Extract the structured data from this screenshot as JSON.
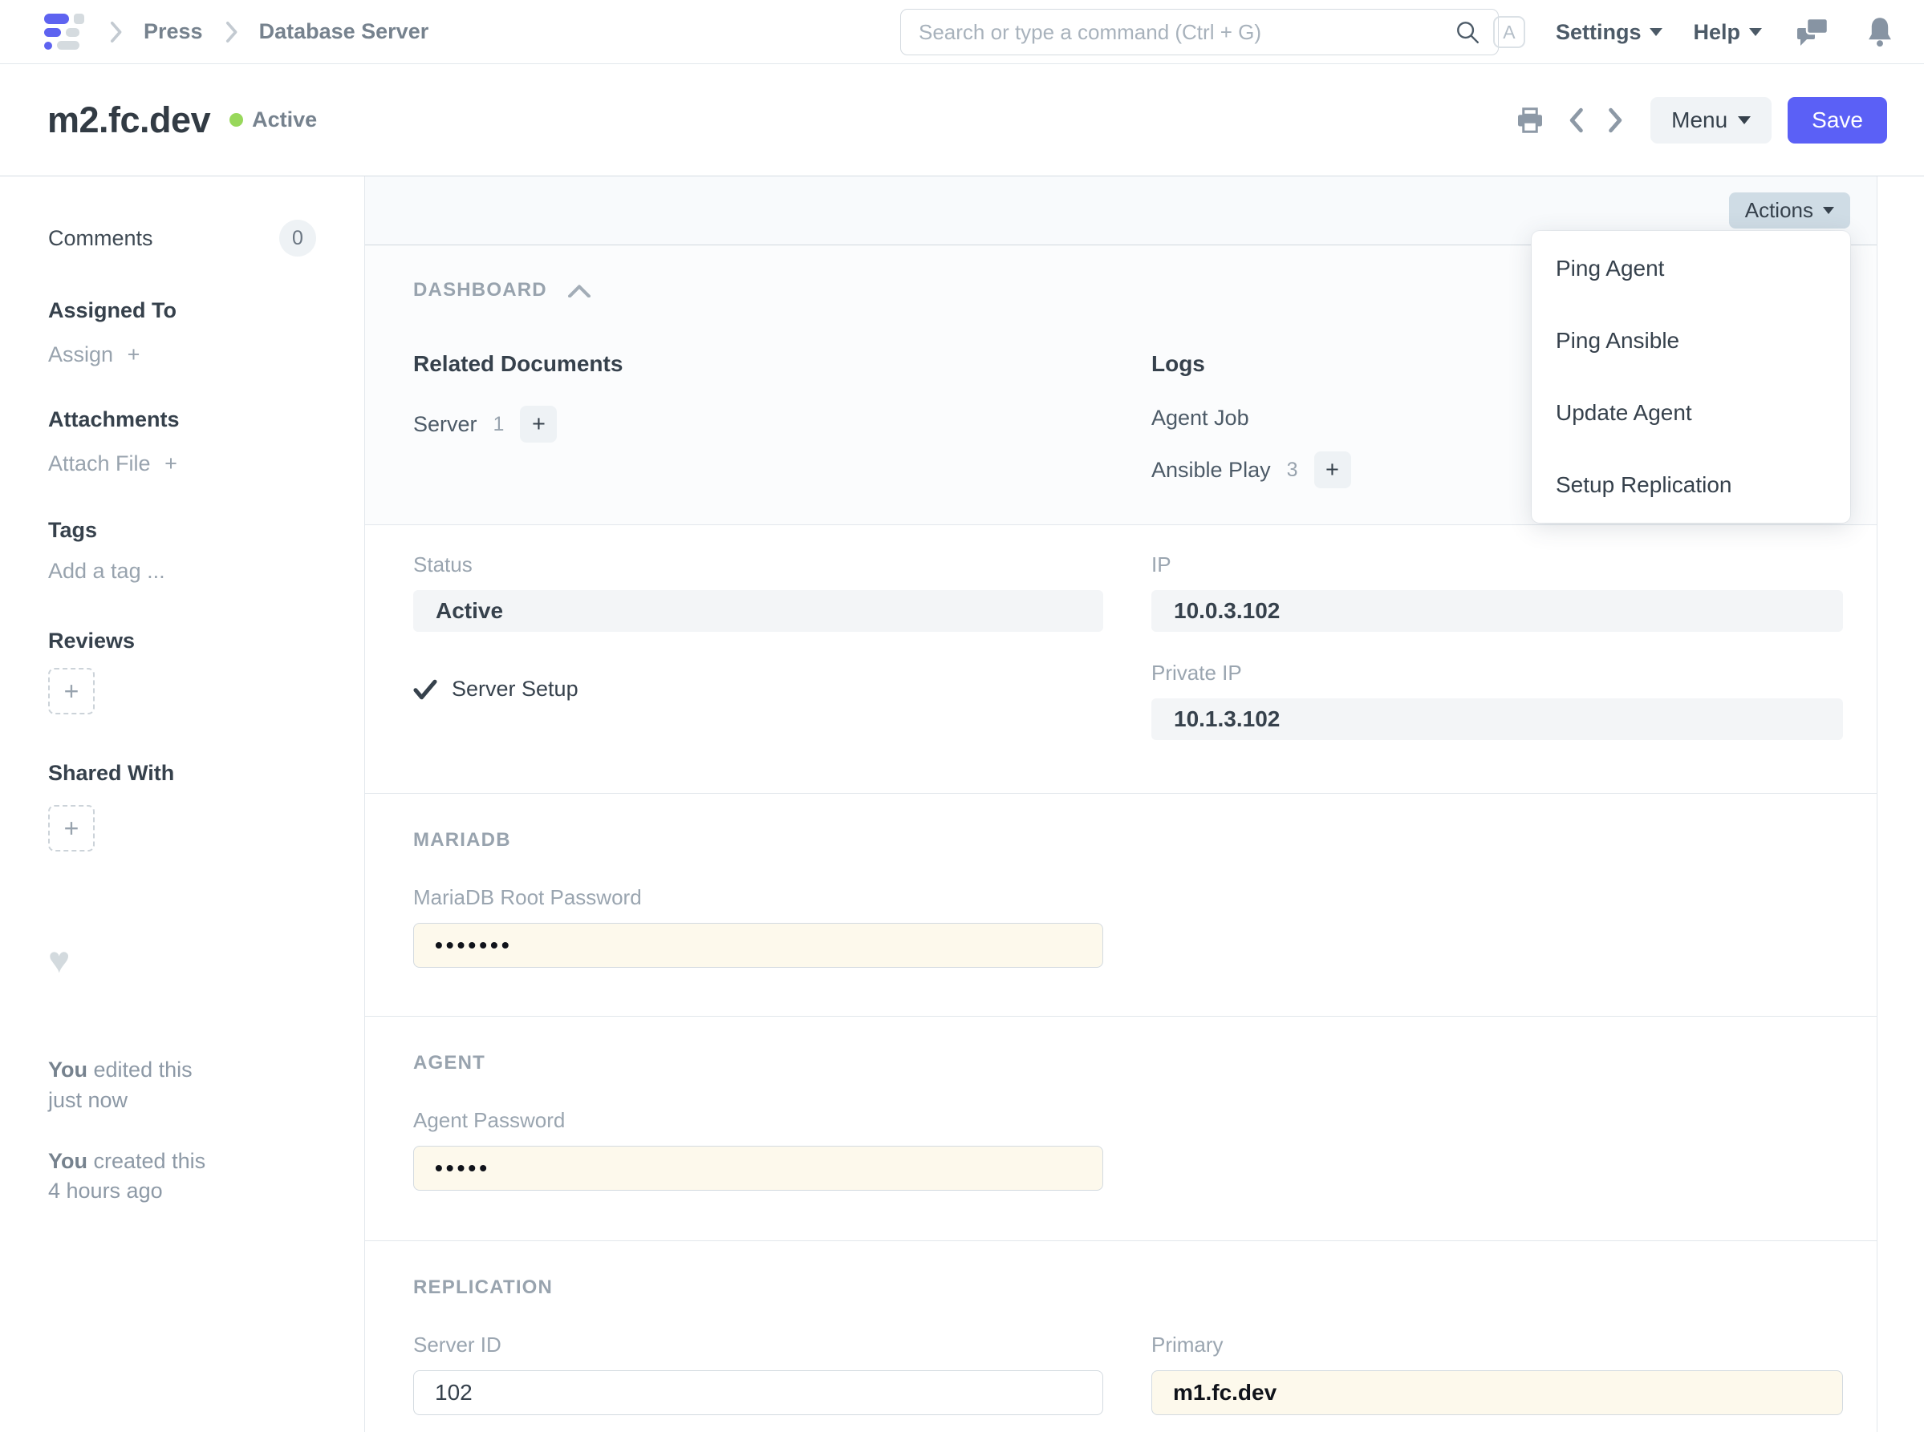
{
  "colors": {
    "accent": "#5b60f6",
    "status_green": "#98d85b",
    "password_field_bg": "#fdf9ec",
    "actions_button_bg": "#cfdce5"
  },
  "icons": {
    "plus": "+",
    "heart": "♥"
  },
  "navbar": {
    "breadcrumbs": [
      {
        "label": "Press"
      },
      {
        "label": "Database Server"
      }
    ],
    "search_placeholder": "Search or type a command (Ctrl + G)",
    "avatar_letter": "A",
    "settings_label": "Settings",
    "help_label": "Help"
  },
  "header": {
    "title": "m2.fc.dev",
    "status_indicator": "Active",
    "menu_label": "Menu",
    "save_label": "Save"
  },
  "sidebar": {
    "comments_label": "Comments",
    "comments_count": "0",
    "assigned_to_label": "Assigned To",
    "assign_label": "Assign",
    "attachments_label": "Attachments",
    "attach_file_label": "Attach File",
    "tags_label": "Tags",
    "add_tag_placeholder": "Add a tag ...",
    "reviews_label": "Reviews",
    "shared_with_label": "Shared With",
    "edited": {
      "who": "You",
      "action": "edited this",
      "when": "just now"
    },
    "created": {
      "who": "You",
      "action": "created this",
      "when": "4 hours ago"
    }
  },
  "actions_menu": {
    "button_label": "Actions",
    "items": [
      "Ping Agent",
      "Ping Ansible",
      "Update Agent",
      "Setup Replication"
    ]
  },
  "dashboard": {
    "section_label": "DASHBOARD",
    "related_documents_label": "Related Documents",
    "related": [
      {
        "label": "Server",
        "count": "1"
      }
    ],
    "logs_label": "Logs",
    "logs": [
      {
        "label": "Agent Job",
        "count": ""
      },
      {
        "label": "Ansible Play",
        "count": "3"
      }
    ]
  },
  "form": {
    "status": {
      "label": "Status",
      "value": "Active"
    },
    "server_setup": {
      "label": "Server Setup",
      "checked": true
    },
    "ip": {
      "label": "IP",
      "value": "10.0.3.102"
    },
    "private_ip": {
      "label": "Private IP",
      "value": "10.1.3.102"
    },
    "mariadb_section_label": "MARIADB",
    "mariadb_root_password": {
      "label": "MariaDB Root Password",
      "value": "•••••••"
    },
    "agent_section_label": "AGENT",
    "agent_password": {
      "label": "Agent Password",
      "value": "•••••"
    },
    "replication_section_label": "REPLICATION",
    "server_id": {
      "label": "Server ID",
      "value": "102"
    },
    "primary": {
      "label": "Primary",
      "value": "m1.fc.dev"
    }
  }
}
